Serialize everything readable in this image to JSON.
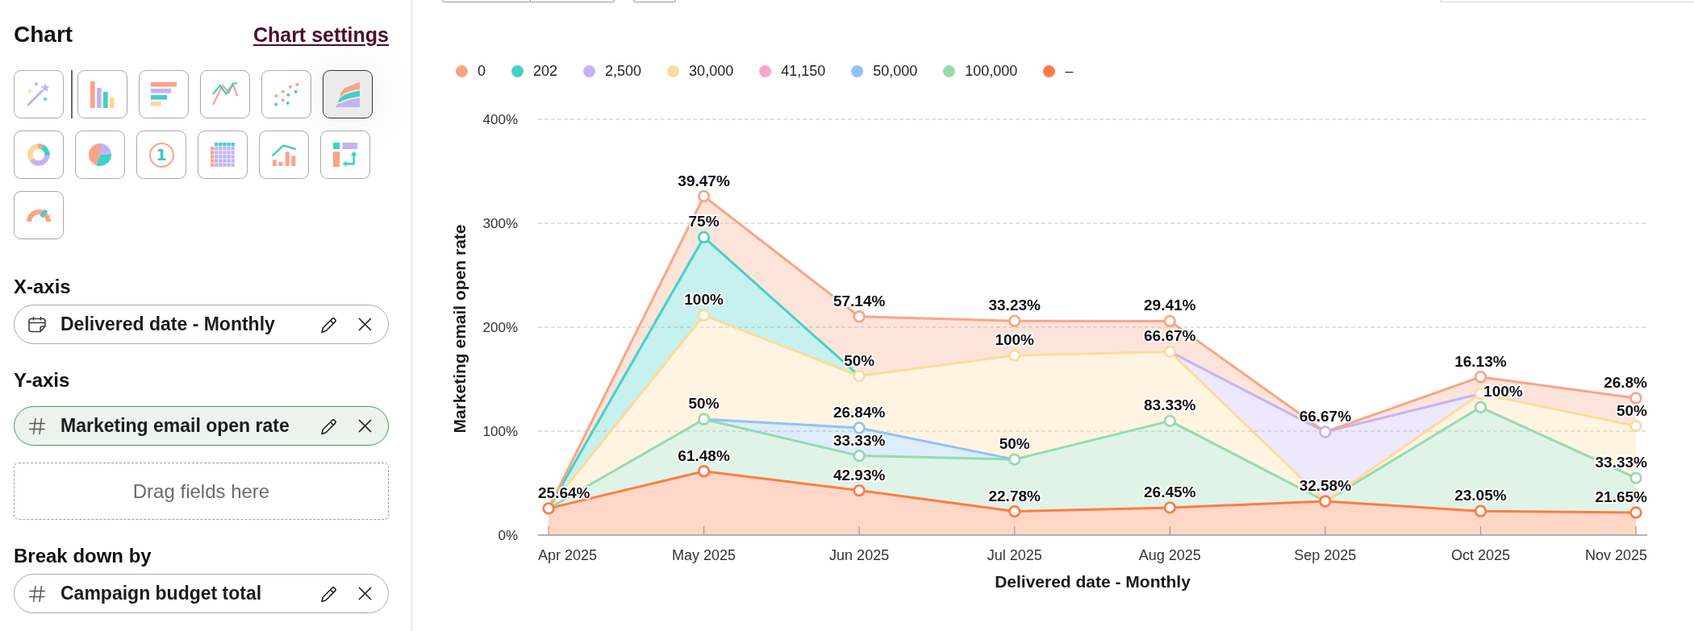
{
  "sidebar": {
    "title": "Chart",
    "settings_link": "Chart settings",
    "chart_types": [
      {
        "kind": "auto",
        "selected": false
      },
      {
        "kind": "bar",
        "selected": false
      },
      {
        "kind": "horizontal_bar",
        "selected": false
      },
      {
        "kind": "line",
        "selected": false
      },
      {
        "kind": "scatter",
        "selected": false
      },
      {
        "kind": "area",
        "selected": true
      },
      {
        "kind": "donut",
        "selected": false
      },
      {
        "kind": "pie",
        "selected": false
      },
      {
        "kind": "kpi",
        "glyph": "1",
        "selected": false
      },
      {
        "kind": "table",
        "selected": false
      },
      {
        "kind": "combo",
        "selected": false
      },
      {
        "kind": "pivot",
        "selected": false
      },
      {
        "kind": "gauge",
        "selected": false
      }
    ],
    "sections": [
      {
        "label": "X-axis",
        "fields": [
          {
            "kind": "date",
            "name": "Delivered date - Monthly",
            "selected": false
          }
        ]
      },
      {
        "label": "Y-axis",
        "fields": [
          {
            "kind": "number",
            "name": "Marketing email open rate",
            "selected": true
          }
        ],
        "drop_zone": "Drag fields here"
      },
      {
        "label": "Break down by",
        "fields": [
          {
            "kind": "number",
            "name": "Campaign budget total",
            "selected": false
          }
        ]
      }
    ]
  },
  "chart_panel": {
    "chart_data": {
      "type": "area",
      "stacked": true,
      "xlabel": "Delivered date - Monthly",
      "ylabel": "Marketing email open rate",
      "categories": [
        "Apr 2025",
        "May 2025",
        "Jun 2025",
        "Jul 2025",
        "Aug 2025",
        "Sep 2025",
        "Oct 2025",
        "Nov 2025"
      ],
      "ylim": [
        0,
        400
      ],
      "yticks": [
        {
          "value": 0,
          "label": "0%"
        },
        {
          "value": 100,
          "label": "100%"
        },
        {
          "value": 200,
          "label": "200%"
        },
        {
          "value": 300,
          "label": "300%"
        },
        {
          "value": 400,
          "label": "400%"
        }
      ],
      "grid": true,
      "legend": "top",
      "data_labels": true,
      "series": [
        {
          "name": "–",
          "color": "#ff7b47",
          "values": [
            25.64,
            61.48,
            42.93,
            22.78,
            26.45,
            32.58,
            23.05,
            21.65
          ],
          "value_labels": [
            "25.64%",
            "61.48%",
            "42.93%",
            "22.78%",
            "26.45%",
            "32.58%",
            "23.05%",
            "21.65%"
          ]
        },
        {
          "name": "100,000",
          "color": "#96dab0",
          "values": [
            0,
            50,
            33.33,
            50,
            83.33,
            0,
            100,
            33.33
          ],
          "value_labels": [
            null,
            "50%",
            "33.33%",
            "50%",
            "83.33%",
            null,
            "100%",
            "33.33%"
          ]
        },
        {
          "name": "50,000",
          "color": "#8ec4f2",
          "values": [
            null,
            0,
            26.84,
            0,
            null,
            null,
            null,
            null
          ],
          "value_labels": [
            null,
            null,
            "26.84%",
            null,
            null,
            null,
            null,
            null
          ]
        },
        {
          "name": "41,150",
          "color": "#f9a4cf",
          "values": [
            null,
            null,
            null,
            null,
            null,
            null,
            null,
            null
          ]
        },
        {
          "name": "30,000",
          "color": "#fcdb9d",
          "values": [
            0,
            100,
            50,
            100,
            66.67,
            0,
            13,
            50
          ],
          "value_labels": [
            null,
            "100%",
            "50%",
            "100%",
            "66.67%",
            null,
            null,
            "50%"
          ]
        },
        {
          "name": "2,500",
          "color": "#c4b4f5",
          "values": [
            null,
            null,
            null,
            null,
            0,
            66.67,
            0,
            null
          ],
          "value_labels": [
            null,
            null,
            null,
            null,
            null,
            "66.67%",
            null,
            null
          ]
        },
        {
          "name": "202",
          "color": "#47d0c8",
          "values": [
            0,
            75,
            0,
            null,
            null,
            null,
            null,
            null
          ],
          "value_labels": [
            null,
            "75%",
            null,
            null,
            null,
            null,
            null,
            null
          ]
        },
        {
          "name": "0",
          "color": "#f9a587",
          "values": [
            0,
            39.47,
            57.14,
            33.23,
            29.41,
            0,
            16.13,
            26.8
          ],
          "value_labels": [
            null,
            "39.47%",
            "57.14%",
            "33.23%",
            "29.41%",
            null,
            "16.13%",
            "26.8%"
          ]
        }
      ]
    }
  }
}
